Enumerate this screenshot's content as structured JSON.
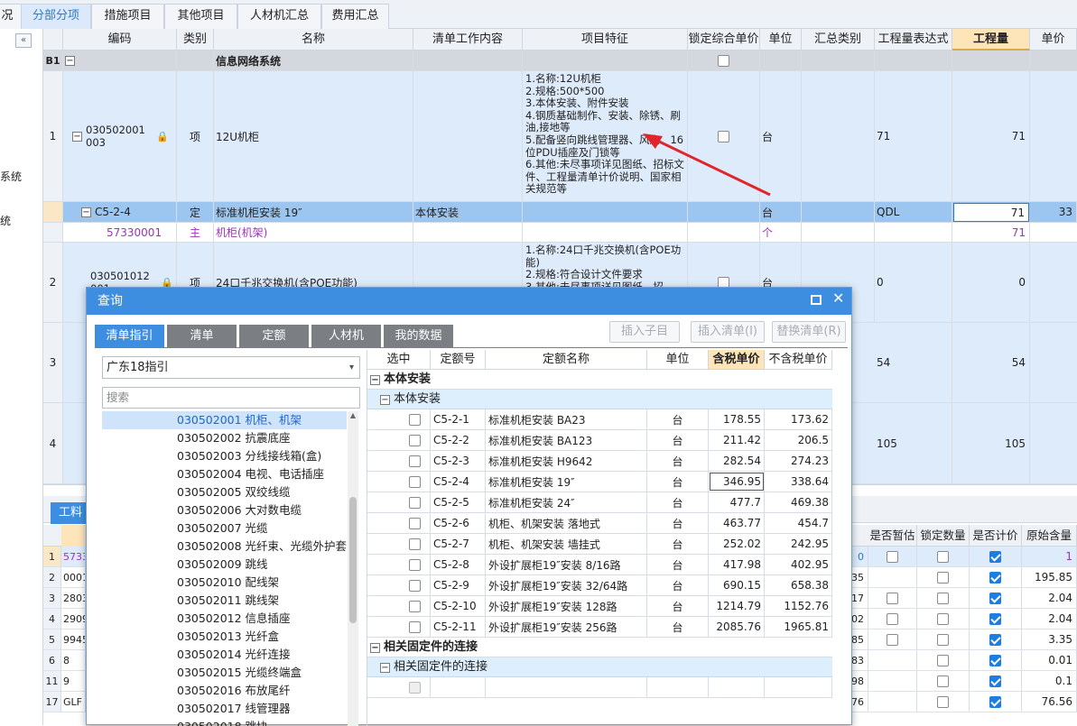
{
  "tabs": [
    "况",
    "分部分项",
    "措施项目",
    "其他项目",
    "人材机汇总",
    "费用汇总"
  ],
  "left_panel": {
    "collapse_icon": "«",
    "items": [
      "系统",
      "统"
    ]
  },
  "grid": {
    "headers": [
      "编码",
      "类别",
      "名称",
      "清单工作内容",
      "项目特征",
      "锁定综合单价",
      "单位",
      "汇总类别",
      "工程量表达式",
      "工程量",
      "单价"
    ],
    "group": {
      "id": "B1",
      "name": "信息网络系统"
    },
    "rows": [
      {
        "no": "1",
        "code": "030502001003",
        "type": "项",
        "name": "12U机柜",
        "features": "1.名称:12U机柜\n2.规格:500*500\n3.本体安装、附件安装\n4.钢质基础制作、安装、除锈、刷油,接地等\n5.配备竖向跳线管理器、风扇、16位PDU插座及门锁等\n6.其他:未尽事项详见图纸、招标文件、工程量清单计价说明、国家相关规范等",
        "unit": "台",
        "expr": "71",
        "qty": "71"
      },
      {
        "no": "",
        "code": "C5-2-4",
        "type": "定",
        "name": "标准机柜安装 19″",
        "work": "本体安装",
        "unit": "台",
        "expr": "QDL",
        "qty": "71",
        "price": "33"
      },
      {
        "no": "",
        "code": "57330001",
        "type": "主",
        "name": "机柜(机架)",
        "unit": "个",
        "qty": "71"
      },
      {
        "no": "2",
        "code": "030501012001",
        "type": "项",
        "name": "24口千兆交换机(含POE功能)",
        "features": "1.名称:24口千兆交换机(含POE功能)\n2.规格:符合设计文件要求\n3.其他:未尽事项详见图纸、招",
        "unit": "台",
        "expr": "0",
        "qty": "0"
      },
      {
        "no": "3",
        "expr": "54",
        "qty": "54"
      },
      {
        "no": "4",
        "expr": "105",
        "qty": "105"
      }
    ]
  },
  "bottom": {
    "tab": "工料",
    "headers": [
      "是否暂估",
      "锁定数量",
      "是否计价",
      "原始含量"
    ],
    "rows": [
      {
        "no": "1",
        "code": "5733",
        "val": "0",
        "orig": "1"
      },
      {
        "no": "2",
        "code": "0001",
        "val": "35",
        "orig": "195.85"
      },
      {
        "no": "3",
        "code": "2803",
        "val": "17",
        "orig": "2.04"
      },
      {
        "no": "4",
        "code": "2909",
        "val": "02",
        "orig": "2.04"
      },
      {
        "no": "5",
        "code": "9945",
        "val": "85",
        "orig": "3.35"
      },
      {
        "no": "6",
        "code": "8",
        "val": "83",
        "orig": "0.01"
      },
      {
        "no": "11",
        "code": "9",
        "val": "98",
        "orig": "0.1"
      },
      {
        "no": "17",
        "code": "GLF",
        "val": "76",
        "orig": "76.56"
      }
    ]
  },
  "dialog": {
    "title": "查询",
    "tabs": [
      "清单指引",
      "清单",
      "定额",
      "人材机",
      "我的数据"
    ],
    "buttons": [
      "插入子目",
      "插入清单(I)",
      "替换清单(R)"
    ],
    "select_value": "广东18指引",
    "search_placeholder": "搜索",
    "tree": [
      "030502001 机柜、机架",
      "030502002 抗震底座",
      "030502003 分线接线箱(盒)",
      "030502004 电视、电话插座",
      "030502005 双绞线缆",
      "030502006 大对数电缆",
      "030502007 光缆",
      "030502008 光纤束、光缆外护套",
      "030502009 跳线",
      "030502010 配线架",
      "030502011 跳线架",
      "030502012 信息插座",
      "030502013 光纤盒",
      "030502014 光纤连接",
      "030502015 光缆终端盒",
      "030502016 布放尾纤",
      "030502017 线管理器",
      "030502018 跳块"
    ],
    "table_headers": [
      "选中",
      "定额号",
      "定额名称",
      "单位",
      "含税单价",
      "不含税单价"
    ],
    "group1": "本体安装",
    "subgroup1": "本体安装",
    "items": [
      {
        "code": "C5-2-1",
        "name": "标准机柜安装 BA23",
        "unit": "台",
        "tax": "178.55",
        "notax": "173.62"
      },
      {
        "code": "C5-2-2",
        "name": "标准机柜安装 BA123",
        "unit": "台",
        "tax": "211.42",
        "notax": "206.5"
      },
      {
        "code": "C5-2-3",
        "name": "标准机柜安装 H9642",
        "unit": "台",
        "tax": "282.54",
        "notax": "274.23"
      },
      {
        "code": "C5-2-4",
        "name": "标准机柜安装 19″",
        "unit": "台",
        "tax": "346.95",
        "notax": "338.64"
      },
      {
        "code": "C5-2-5",
        "name": "标准机柜安装 24″",
        "unit": "台",
        "tax": "477.7",
        "notax": "469.38"
      },
      {
        "code": "C5-2-6",
        "name": "机柜、机架安装 落地式",
        "unit": "台",
        "tax": "463.77",
        "notax": "454.7"
      },
      {
        "code": "C5-2-7",
        "name": "机柜、机架安装 墙挂式",
        "unit": "台",
        "tax": "252.02",
        "notax": "242.95"
      },
      {
        "code": "C5-2-8",
        "name": "外设扩展柜19″安装 8/16路",
        "unit": "台",
        "tax": "417.98",
        "notax": "402.95"
      },
      {
        "code": "C5-2-9",
        "name": "外设扩展柜19″安装 32/64路",
        "unit": "台",
        "tax": "690.15",
        "notax": "658.38"
      },
      {
        "code": "C5-2-10",
        "name": "外设扩展柜19″安装 128路",
        "unit": "台",
        "tax": "1214.79",
        "notax": "1152.76"
      },
      {
        "code": "C5-2-11",
        "name": "外设扩展柜19″安装 256路",
        "unit": "台",
        "tax": "2085.76",
        "notax": "1965.81"
      }
    ],
    "group2": "相关固定件的连接",
    "subgroup2": "相关固定件的连接"
  },
  "colors": {
    "accent": "#3d8ee0",
    "selected_row": "#9cc6f0",
    "highlight_header": "#fde4b9",
    "arrow": "#e0262c"
  }
}
